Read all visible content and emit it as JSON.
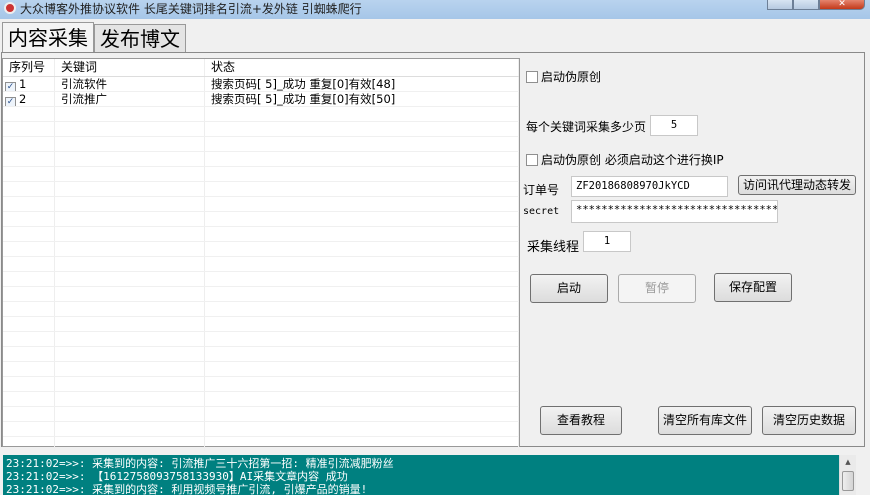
{
  "window": {
    "title": "大众博客外推协议软件 长尾关键词排名引流+发外链 引蜘蛛爬行",
    "close": "✕"
  },
  "tabs": [
    {
      "label": "内容采集"
    },
    {
      "label": "发布博文"
    }
  ],
  "grid": {
    "headers": [
      "序列号",
      "关键词",
      "状态"
    ],
    "rows": [
      {
        "checked": true,
        "index": "1",
        "keyword": "引流软件",
        "status": "搜索页码[ 5]_成功 重复[0]有效[48]"
      },
      {
        "checked": true,
        "index": "2",
        "keyword": "引流推广",
        "status": "搜索页码[ 5]_成功 重复[0]有效[50]"
      }
    ]
  },
  "settings": {
    "pseudo_original_label": "启动伪原创",
    "pages_label": "每个关键词采集多少页",
    "pages_value": "5",
    "ip_label": "启动伪原创 必须启动这个进行换IP",
    "order_label": "订单号",
    "order_value": "ZF20186808970JkYCD",
    "proxy_button": "访问讯代理动态转发",
    "secret_label": "secret",
    "secret_value": "********************************",
    "threads_label": "采集线程",
    "threads_value": "1",
    "start_button": "启动",
    "pause_button": "暂停",
    "save_button": "保存配置",
    "tutorial_button": "查看教程",
    "clear_files_button": "清空所有库文件",
    "clear_history_button": "清空历史数据"
  },
  "log": [
    "23:21:02=>>: 采集到的内容: 引流推广三十六招第一招: 精准引流减肥粉丝",
    "23:21:02=>>: 【1612758093758133930】AI采集文章内容 成功",
    "23:21:02=>>: 采集到的内容: 利用视频号推广引流, 引爆产品的销量!"
  ],
  "colors": {
    "log_bg": "#008080"
  }
}
